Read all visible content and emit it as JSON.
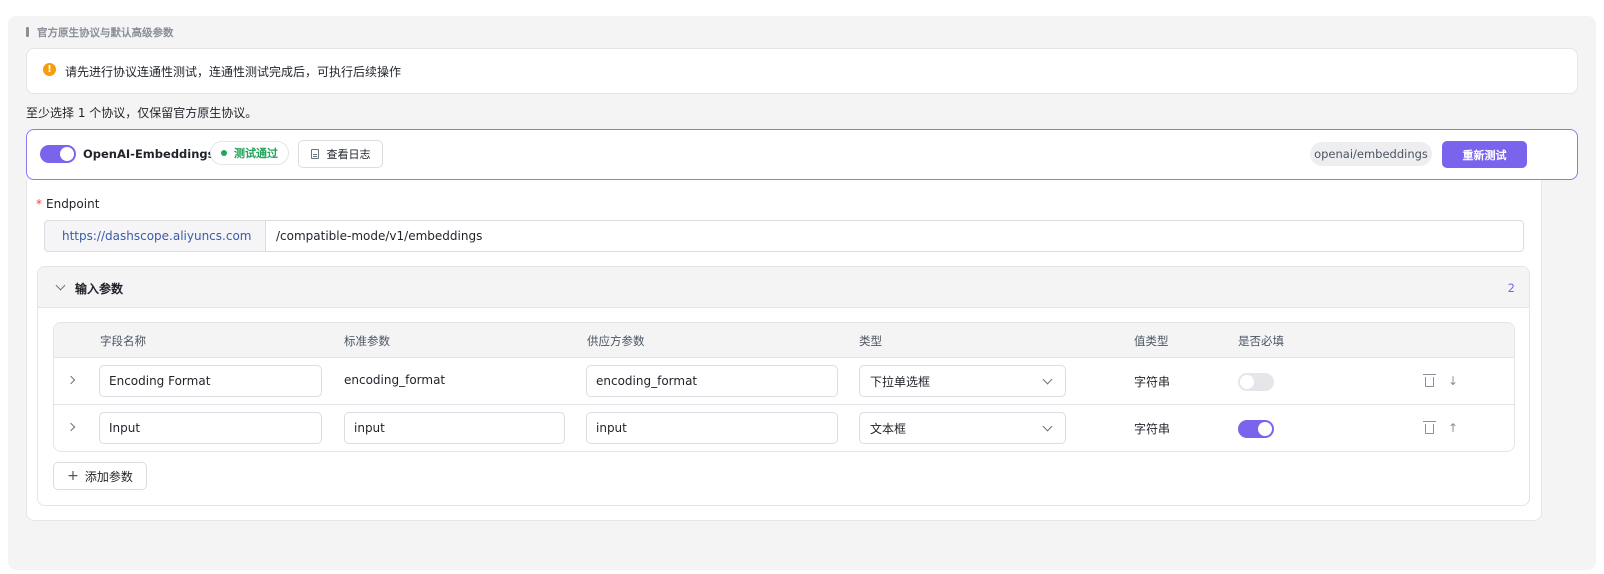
{
  "section": {
    "title": "官方原生协议与默认高级参数"
  },
  "alert": {
    "text": "请先进行协议连通性测试，连通性测试完成后，可执行后续操作"
  },
  "hint": "至少选择 1 个协议，仅保留官方原生协议。",
  "protocol": {
    "enabled": true,
    "name": "OpenAI-Embeddings",
    "status": "测试通过",
    "log_button": "查看日志",
    "path": "openai/embeddings",
    "retest_button": "重新测试"
  },
  "endpoint": {
    "label": "Endpoint",
    "required_mark": "*",
    "base_url": "https://dashscope.aliyuncs.com",
    "path": "/compatible-mode/v1/embeddings"
  },
  "params": {
    "title": "输入参数",
    "count": "2",
    "columns": [
      "字段名称",
      "标准参数",
      "供应方参数",
      "类型",
      "值类型",
      "是否必填"
    ],
    "rows": [
      {
        "field_name": "Encoding Format",
        "standard": "encoding_format",
        "vendor": "encoding_format",
        "type": "下拉单选框",
        "value_type": "字符串",
        "required": false,
        "move": "↓"
      },
      {
        "field_name": "Input",
        "standard": "input",
        "vendor": "input",
        "type": "文本框",
        "value_type": "字符串",
        "required": true,
        "move": "↑"
      }
    ],
    "add_button": "添加参数"
  },
  "colors": {
    "accent": "#7a64ee",
    "success": "#22a55a",
    "warning": "#f59e0b"
  }
}
